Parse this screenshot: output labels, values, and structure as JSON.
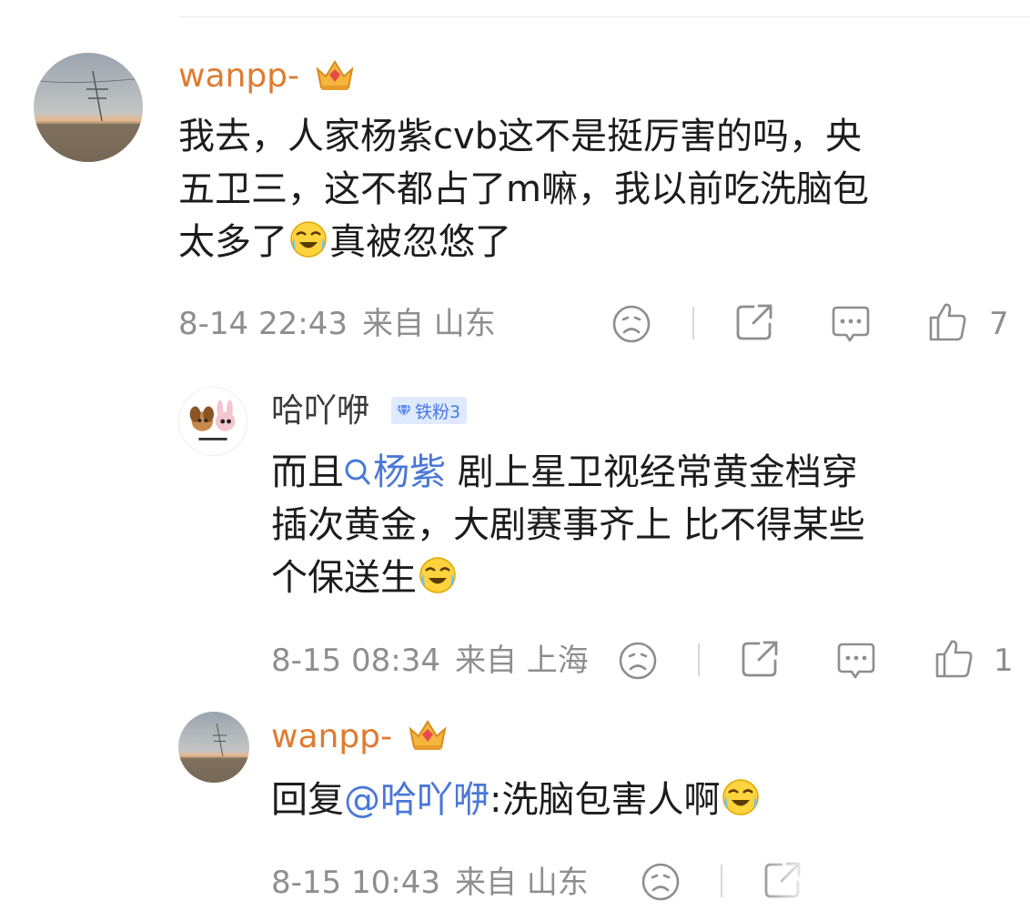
{
  "comments": [
    {
      "username": "wanpp-",
      "lines": [
        "我去，人家杨紫cvb这不是挺厉害的吗，央",
        "五卫三，这不都占了m嘛，我以前吃洗脑包",
        "太多了",
        "真被忽悠了"
      ],
      "time": "8-14 22:43",
      "location": "来自 山东",
      "like_count": "7"
    }
  ],
  "replies": [
    {
      "username": "哈吖咿",
      "badge": "铁粉3",
      "lines": {
        "l1_pre": "而且",
        "l1_mention": "杨紫",
        "l1_post": " 剧上星卫视经常黄金档穿",
        "l2": "插次黄金，大剧赛事齐上 比不得某些",
        "l3": "个保送生"
      },
      "time": "8-15 08:34",
      "location": "来自 上海",
      "like_count": "1"
    },
    {
      "username": "wanpp-",
      "prefix": "回复",
      "mention": "@哈吖咿",
      "text": ":洗脑包害人啊",
      "time": "8-15 10:43",
      "location": "来自 山东"
    }
  ],
  "icons": {
    "crown": "crown-vip-icon",
    "dislike": "frown-face-icon",
    "share": "share-icon",
    "comment": "comment-bubble-icon",
    "like": "thumbs-up-icon",
    "emoji": "laugh-cry-emoji-icon"
  },
  "colors": {
    "username_vip": "#e07b2f",
    "mention": "#4a78d8",
    "meta": "#8e8e8e",
    "badge_bg": "#dfeaff"
  }
}
